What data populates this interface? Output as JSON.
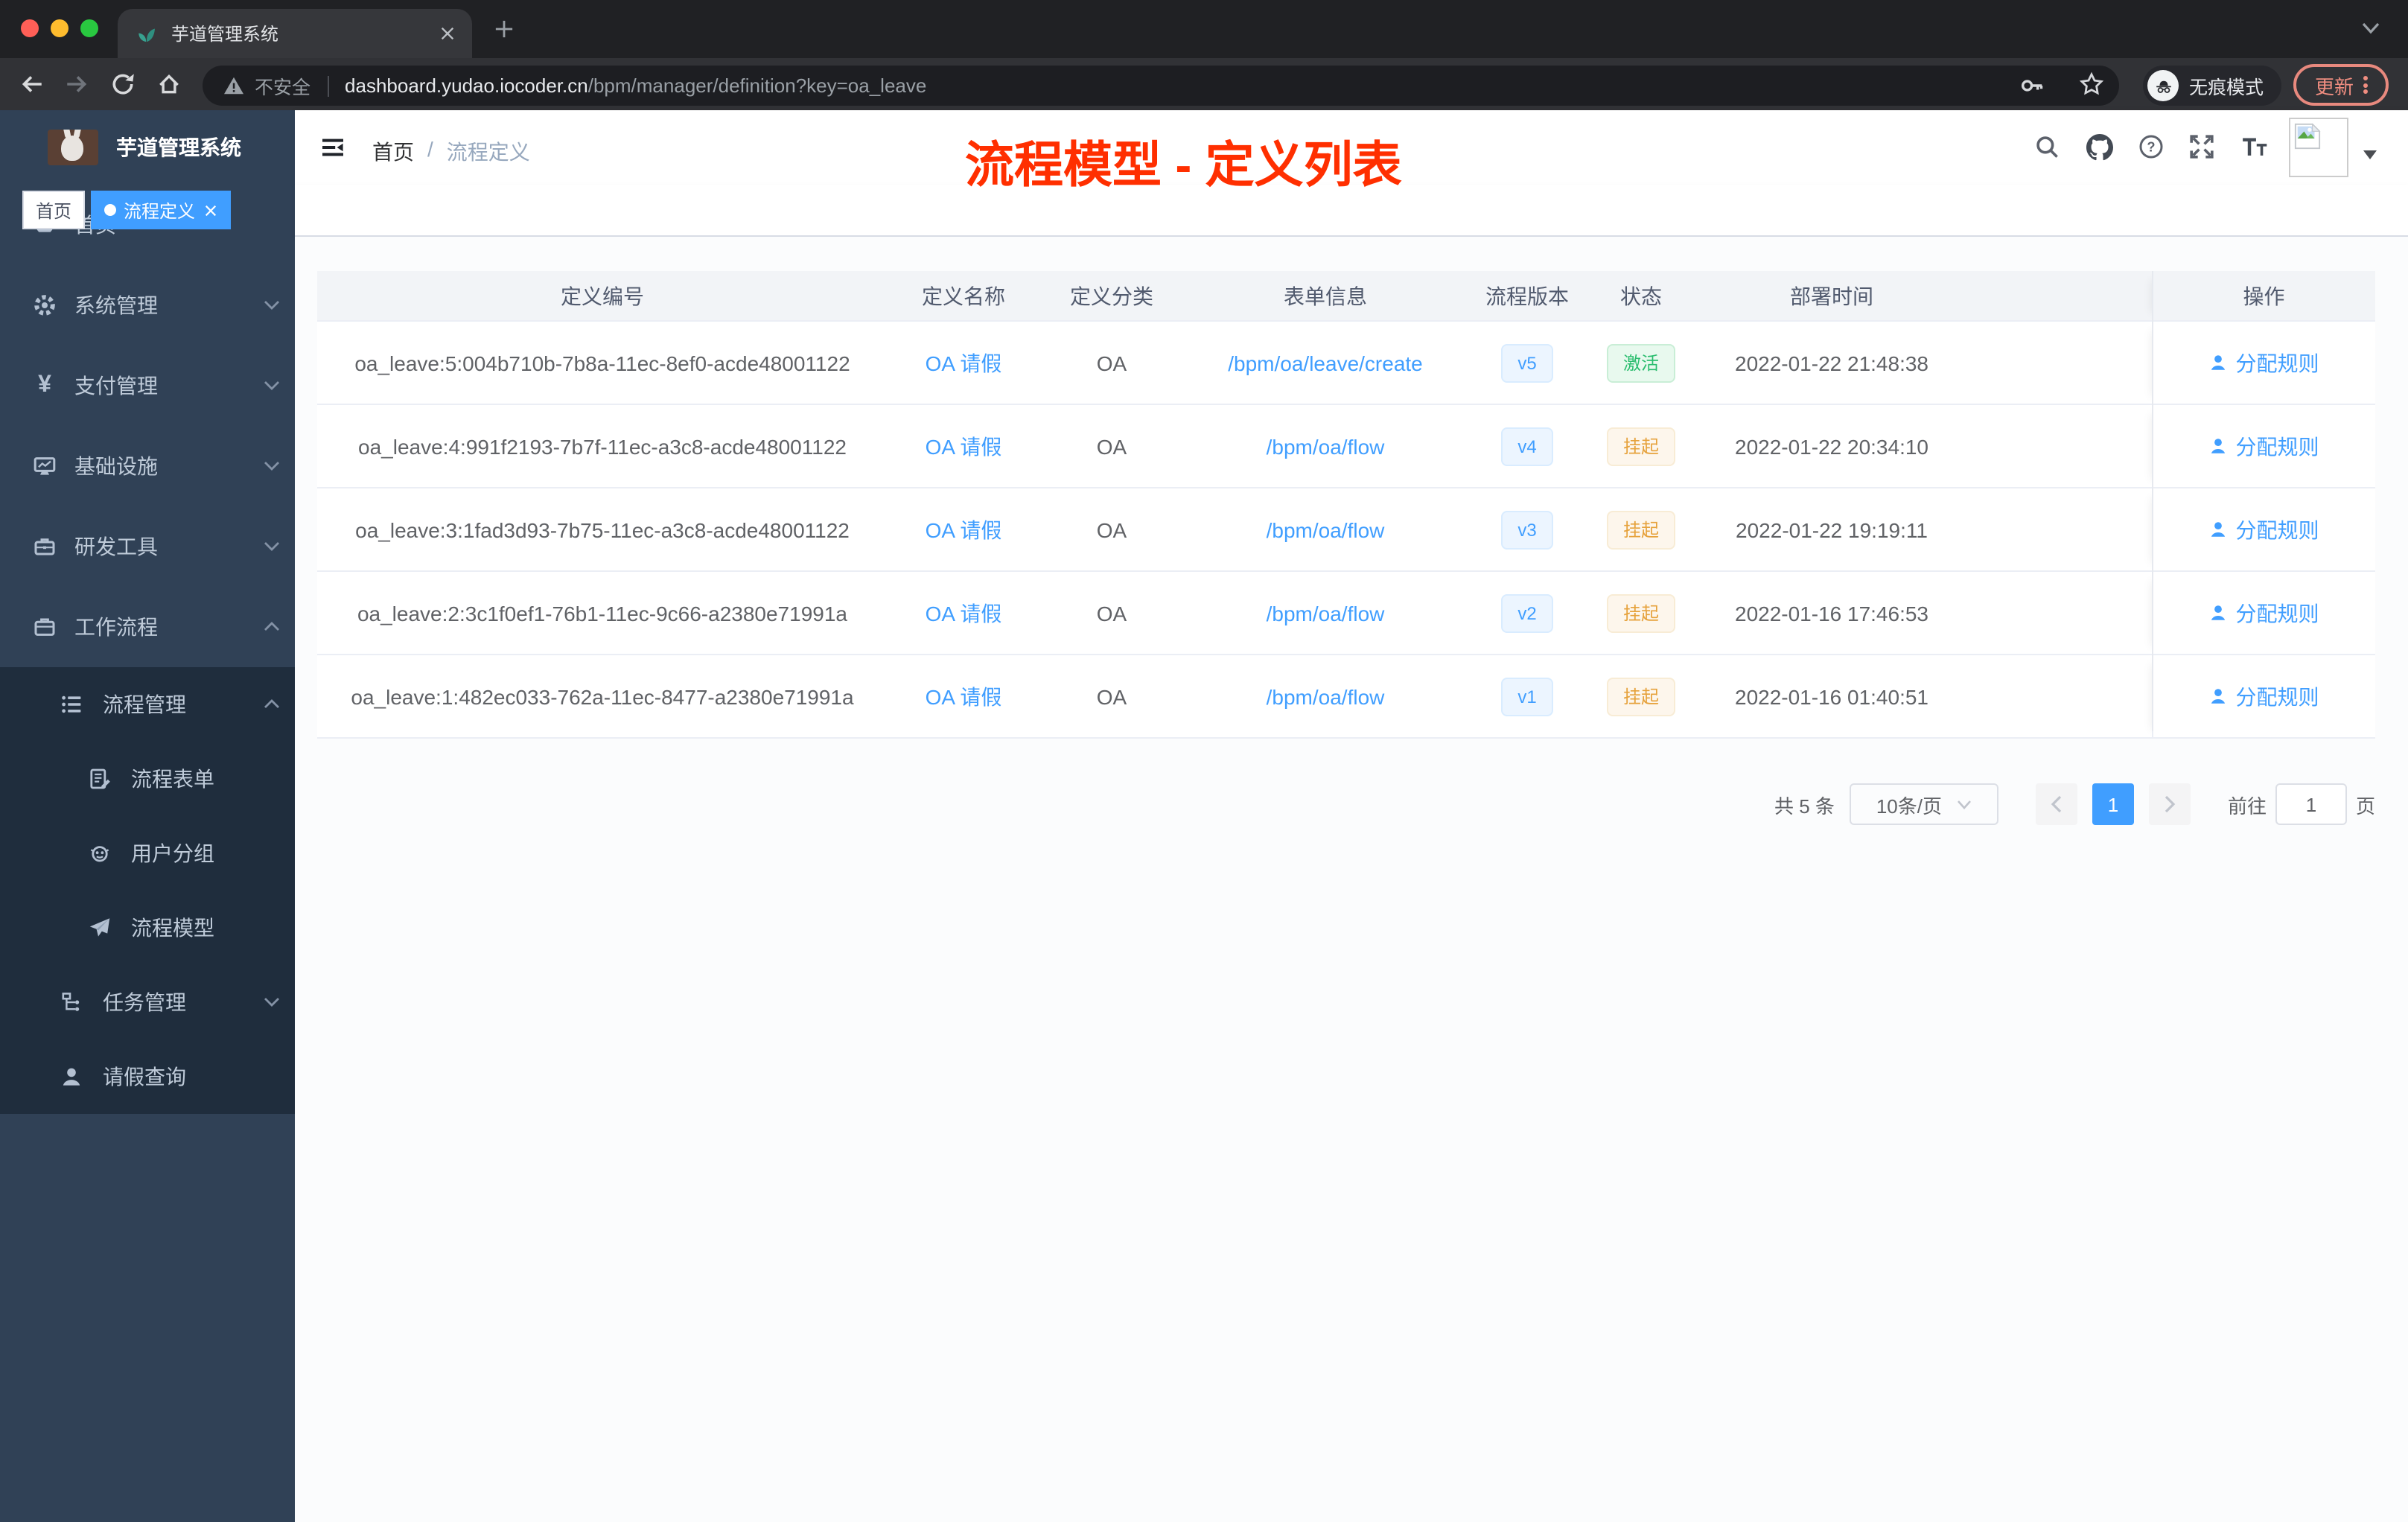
{
  "window": {
    "tab_title": "芋道管理系统",
    "security_label": "不安全",
    "url_host": "dashboard.yudao.iocoder.cn",
    "url_path": "/bpm/manager/definition?key=oa_leave",
    "incognito_label": "无痕模式",
    "update_label": "更新"
  },
  "sidebar": {
    "app_title": "芋道管理系统",
    "menu": [
      {
        "label": "首页",
        "icon": "dashboard-icon"
      },
      {
        "label": "系统管理",
        "icon": "gear-icon",
        "arrow": "down"
      },
      {
        "label": "支付管理",
        "icon": "yen-icon",
        "arrow": "down"
      },
      {
        "label": "基础设施",
        "icon": "monitor-icon",
        "arrow": "down"
      },
      {
        "label": "研发工具",
        "icon": "toolbox-icon",
        "arrow": "down"
      },
      {
        "label": "工作流程",
        "icon": "briefcase-icon",
        "arrow": "up"
      }
    ],
    "submenu": [
      {
        "label": "流程管理",
        "icon": "list-icon",
        "arrow": "up",
        "level": 2
      },
      {
        "label": "流程表单",
        "icon": "form-icon",
        "level": 3
      },
      {
        "label": "用户分组",
        "icon": "robot-icon",
        "level": 3
      },
      {
        "label": "流程模型",
        "icon": "send-icon",
        "level": 3
      },
      {
        "label": "任务管理",
        "icon": "tree-icon",
        "arrow": "down",
        "level": 2
      },
      {
        "label": "请假查询",
        "icon": "user-icon",
        "level": 2
      }
    ]
  },
  "navbar": {
    "breadcrumb_home": "首页",
    "breadcrumb_sep": "/",
    "breadcrumb_current": "流程定义"
  },
  "annotation": "流程模型 - 定义列表",
  "tags": {
    "home": "首页",
    "active": "流程定义"
  },
  "icons": {
    "yen": "¥",
    "help_mark": "?"
  },
  "table": {
    "headers": {
      "id": "定义编号",
      "name": "定义名称",
      "category": "定义分类",
      "form": "表单信息",
      "version": "流程版本",
      "status": "状态",
      "deploy_time": "部署时间",
      "actions": "操作"
    },
    "rows": [
      {
        "id": "oa_leave:5:004b710b-7b8a-11ec-8ef0-acde48001122",
        "name": "OA 请假",
        "category": "OA",
        "form": "/bpm/oa/leave/create",
        "version": "v5",
        "status": "激活",
        "status_type": "success",
        "time": "2022-01-22 21:48:38",
        "action": "分配规则"
      },
      {
        "id": "oa_leave:4:991f2193-7b7f-11ec-a3c8-acde48001122",
        "name": "OA 请假",
        "category": "OA",
        "form": "/bpm/oa/flow",
        "version": "v4",
        "status": "挂起",
        "status_type": "warning",
        "time": "2022-01-22 20:34:10",
        "action": "分配规则"
      },
      {
        "id": "oa_leave:3:1fad3d93-7b75-11ec-a3c8-acde48001122",
        "name": "OA 请假",
        "category": "OA",
        "form": "/bpm/oa/flow",
        "version": "v3",
        "status": "挂起",
        "status_type": "warning",
        "time": "2022-01-22 19:19:11",
        "action": "分配规则"
      },
      {
        "id": "oa_leave:2:3c1f0ef1-76b1-11ec-9c66-a2380e71991a",
        "name": "OA 请假",
        "category": "OA",
        "form": "/bpm/oa/flow",
        "version": "v2",
        "status": "挂起",
        "status_type": "warning",
        "time": "2022-01-16 17:46:53",
        "action": "分配规则"
      },
      {
        "id": "oa_leave:1:482ec033-762a-11ec-8477-a2380e71991a",
        "name": "OA 请假",
        "category": "OA",
        "form": "/bpm/oa/flow",
        "version": "v1",
        "status": "挂起",
        "status_type": "warning",
        "time": "2022-01-16 01:40:51",
        "action": "分配规则"
      }
    ]
  },
  "pagination": {
    "total": "共 5 条",
    "page_size": "10条/页",
    "current_page": "1",
    "goto_label": "前往",
    "goto_value": "1",
    "unit_label": "页"
  },
  "colors": {
    "accent": "#409eff",
    "sidebar_bg": "#304156",
    "submenu_bg": "#1f2d3d",
    "success_text": "#2abd6e",
    "warning_text": "#e6a23c",
    "annotation_red": "#ff2f00",
    "update_chip": "#ef8d80"
  }
}
